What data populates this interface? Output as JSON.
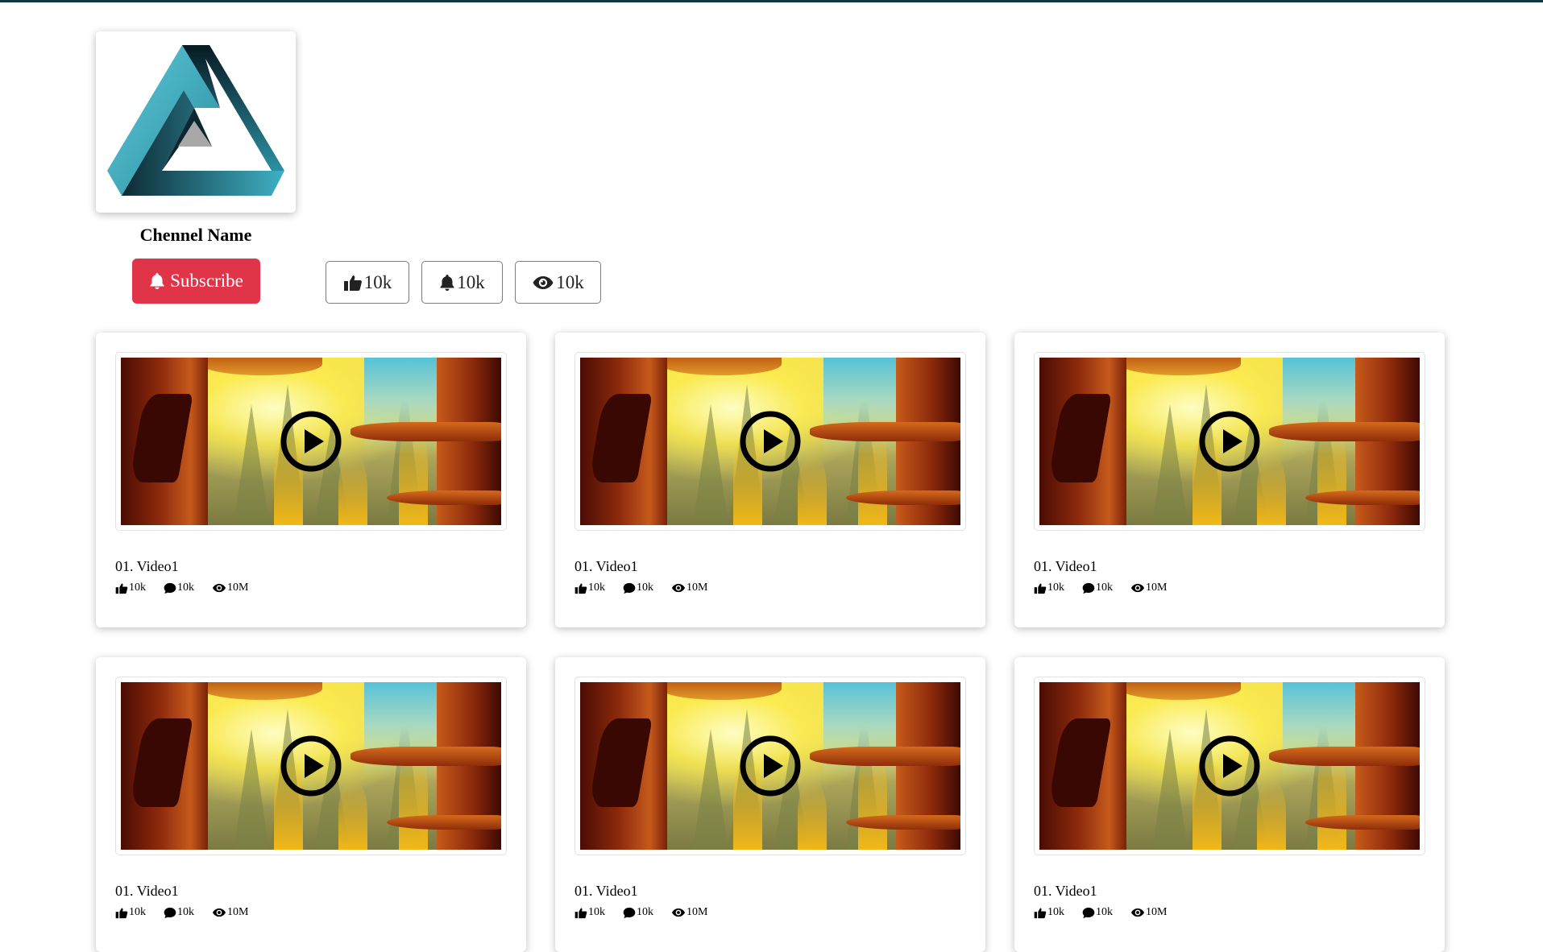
{
  "channel": {
    "name": "Chennel Name",
    "subscribe_label": "Subscribe",
    "stats": [
      {
        "icon": "thumbs-up-icon",
        "value": "10k"
      },
      {
        "icon": "bell-icon",
        "value": "10k"
      },
      {
        "icon": "eye-icon",
        "value": "10k"
      }
    ]
  },
  "videos": [
    {
      "title": "01. Video1",
      "likes": "10k",
      "comments": "10k",
      "views": "10M"
    },
    {
      "title": "01. Video1",
      "likes": "10k",
      "comments": "10k",
      "views": "10M"
    },
    {
      "title": "01. Video1",
      "likes": "10k",
      "comments": "10k",
      "views": "10M"
    },
    {
      "title": "01. Video1",
      "likes": "10k",
      "comments": "10k",
      "views": "10M"
    },
    {
      "title": "01. Video1",
      "likes": "10k",
      "comments": "10k",
      "views": "10M"
    },
    {
      "title": "01. Video1",
      "likes": "10k",
      "comments": "10k",
      "views": "10M"
    }
  ],
  "colors": {
    "accent": "#e03448",
    "topbar": "#0f3a44"
  }
}
